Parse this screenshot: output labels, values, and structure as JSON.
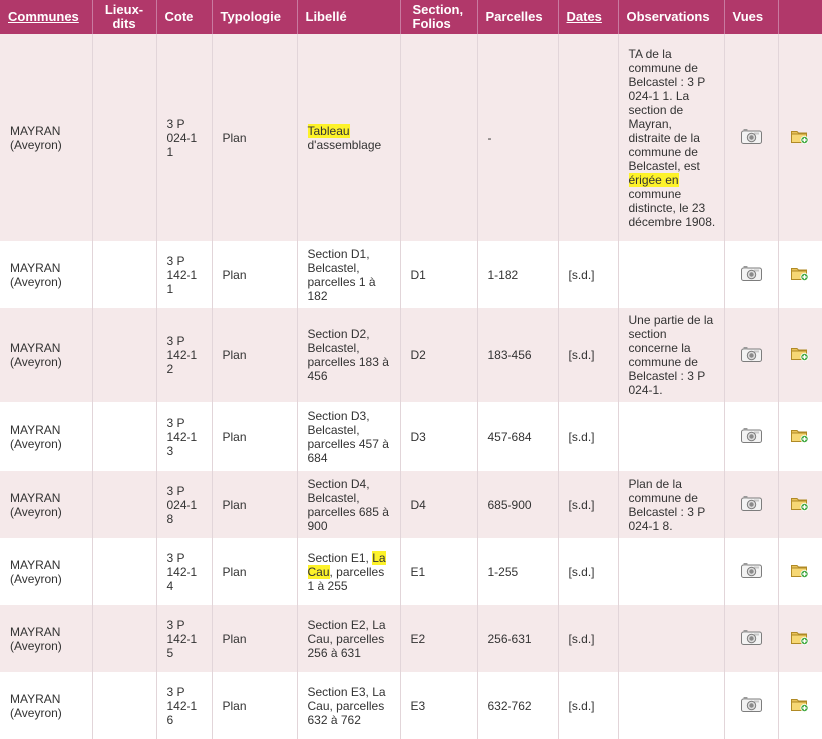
{
  "headers": {
    "communes": "Communes",
    "lieux_dits": "Lieux-dits",
    "cote": "Cote",
    "typologie": "Typologie",
    "libelle": "Libellé",
    "section_folios": "Section, Folios",
    "parcelles": "Parcelles",
    "dates": "Dates",
    "observations": "Observations",
    "vues": "Vues"
  },
  "icons": {
    "camera": "camera-icon",
    "folder_add": "folder-add-icon"
  },
  "colors": {
    "header_bg": "#b1386a",
    "row_alt_bg": "#f5e9ea",
    "highlight": "#fdf22a"
  },
  "rows": [
    {
      "commune": "MAYRAN (Aveyron)",
      "lieux_dits": "",
      "cote": "3 P 024-1 1",
      "typologie": "Plan",
      "libelle_a": "Tableau",
      "libelle_b": "d'assemblage",
      "section": "",
      "parcelles": "-",
      "dates": "",
      "obs_a": "TA de la commune de Belcastel : 3 P 024-1 1. La section de Mayran, distraite de la commune de Belcastel, est ",
      "obs_hl": "érigée en",
      "obs_b": " commune distincte, le 23 décembre 1908."
    },
    {
      "commune": "MAYRAN (Aveyron)",
      "lieux_dits": "",
      "cote": "3 P 142-1 1",
      "typologie": "Plan",
      "libelle": "Section D1, Belcastel, parcelles 1 à 182",
      "section": "D1",
      "parcelles": "1-182",
      "dates": "[s.d.]",
      "observations": ""
    },
    {
      "commune": "MAYRAN (Aveyron)",
      "lieux_dits": "",
      "cote": "3 P 142-1 2",
      "typologie": "Plan",
      "libelle": "Section D2, Belcastel, parcelles 183 à 456",
      "section": "D2",
      "parcelles": "183-456",
      "dates": "[s.d.]",
      "observations": "Une partie de la section concerne la commune de Belcastel : 3 P 024-1."
    },
    {
      "commune": "MAYRAN (Aveyron)",
      "lieux_dits": "",
      "cote": "3 P 142-1 3",
      "typologie": "Plan",
      "libelle": "Section D3, Belcastel, parcelles 457 à 684",
      "section": "D3",
      "parcelles": "457-684",
      "dates": "[s.d.]",
      "observations": ""
    },
    {
      "commune": "MAYRAN (Aveyron)",
      "lieux_dits": "",
      "cote": "3 P 024-1 8",
      "typologie": "Plan",
      "libelle": "Section D4, Belcastel, parcelles 685 à 900",
      "section": "D4",
      "parcelles": "685-900",
      "dates": "[s.d.]",
      "observations": "Plan de la commune de Belcastel : 3 P 024-1 8."
    },
    {
      "commune": "MAYRAN (Aveyron)",
      "lieux_dits": "",
      "cote": "3 P 142-1 4",
      "typologie": "Plan",
      "libelle_a": "Section E1, ",
      "libelle_hl": "La Cau",
      "libelle_b": ", parcelles 1 à 255",
      "section": "E1",
      "parcelles": "1-255",
      "dates": "[s.d.]",
      "observations": ""
    },
    {
      "commune": "MAYRAN (Aveyron)",
      "lieux_dits": "",
      "cote": "3 P 142-1 5",
      "typologie": "Plan",
      "libelle": "Section E2, La Cau, parcelles 256 à 631",
      "section": "E2",
      "parcelles": "256-631",
      "dates": "[s.d.]",
      "observations": ""
    },
    {
      "commune": "MAYRAN (Aveyron)",
      "lieux_dits": "",
      "cote": "3 P 142-1 6",
      "typologie": "Plan",
      "libelle": "Section E3, La Cau, parcelles 632 à 762",
      "section": "E3",
      "parcelles": "632-762",
      "dates": "[s.d.]",
      "observations": ""
    }
  ]
}
